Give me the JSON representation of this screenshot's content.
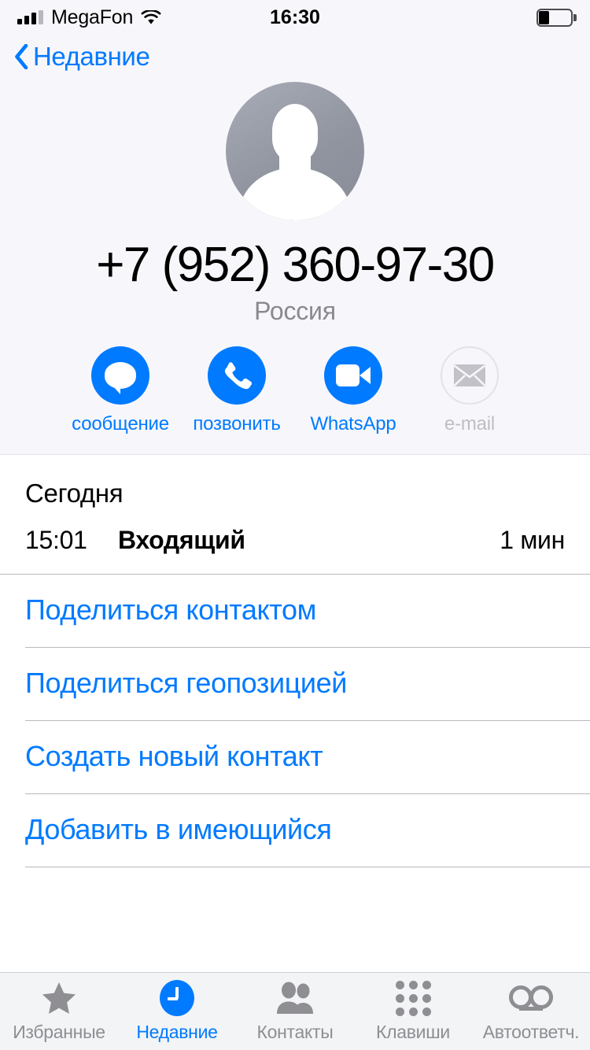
{
  "status_bar": {
    "carrier": "MegaFon",
    "time": "16:30",
    "signal_bars_filled": 3,
    "signal_bars_total": 4,
    "wifi": "wifi-icon",
    "battery_percent": 35
  },
  "nav": {
    "back_label": "Недавние",
    "back_icon": "chevron-left-icon",
    "accent_color": "#007AFF"
  },
  "contact": {
    "avatar_icon": "person-placeholder-icon",
    "phone_number": "+7 (952) 360-97-30",
    "country": "Россия",
    "actions": [
      {
        "label": "сообщение",
        "icon": "message-bubble-icon",
        "enabled": true
      },
      {
        "label": "позвонить",
        "icon": "phone-handset-icon",
        "enabled": true
      },
      {
        "label": "WhatsApp",
        "icon": "video-camera-icon",
        "enabled": true
      },
      {
        "label": "e-mail",
        "icon": "envelope-icon",
        "enabled": false
      }
    ]
  },
  "call_log": {
    "day_header": "Сегодня",
    "entries": [
      {
        "time": "15:01",
        "type": "Входящий",
        "duration": "1 мин"
      }
    ]
  },
  "contact_actions": [
    {
      "label": "Поделиться контактом"
    },
    {
      "label": "Поделиться геопозицией"
    },
    {
      "label": "Создать новый контакт"
    },
    {
      "label": "Добавить в имеющийся"
    }
  ],
  "tab_bar": {
    "active_index": 1,
    "tabs": [
      {
        "label": "Избранные",
        "icon": "star-icon"
      },
      {
        "label": "Недавние",
        "icon": "clock-icon"
      },
      {
        "label": "Контакты",
        "icon": "people-icon"
      },
      {
        "label": "Клавиши",
        "icon": "keypad-icon"
      },
      {
        "label": "Автоответч.",
        "icon": "voicemail-icon"
      }
    ]
  }
}
